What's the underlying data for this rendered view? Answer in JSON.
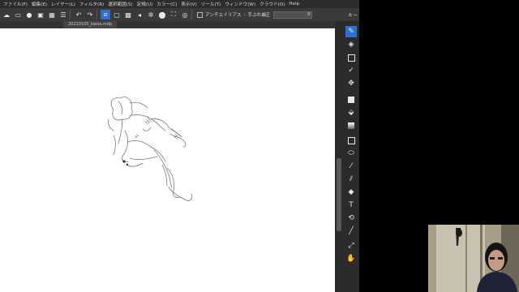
{
  "menu": [
    "ファイル(F)",
    "編集(E)",
    "レイヤー(L)",
    "フィルタ(R)",
    "選択範囲(S)",
    "定規(U)",
    "カラー(C)",
    "表示(V)",
    "ツール(T)",
    "ウィンドウ(W)",
    "クラウド(O)",
    "Help"
  ],
  "toolbar": {
    "antialias_label": "アンチエイリアス",
    "stabilizer_label": "手ぶれ補正",
    "stabilizer_value": "0",
    "panel_label": "キー"
  },
  "document": {
    "tab_title": "20210105_kaioa.mdp"
  },
  "colors": {
    "accent": "#2f6fd0",
    "canvas": "#ffffff",
    "chrome": "#2b2b2b"
  },
  "tools": [
    "pen-icon",
    "eraser-icon",
    "select-rect-icon",
    "check-icon",
    "move-icon",
    "square-fill-icon",
    "bucket-icon",
    "gradient-icon",
    "rect-shape-icon",
    "ellipse-shape-icon",
    "eyedropper-icon",
    "brush-icon",
    "blur-icon",
    "text-icon",
    "hand-rotate-icon",
    "smudge-icon",
    "dropper-icon",
    "hand-icon"
  ]
}
